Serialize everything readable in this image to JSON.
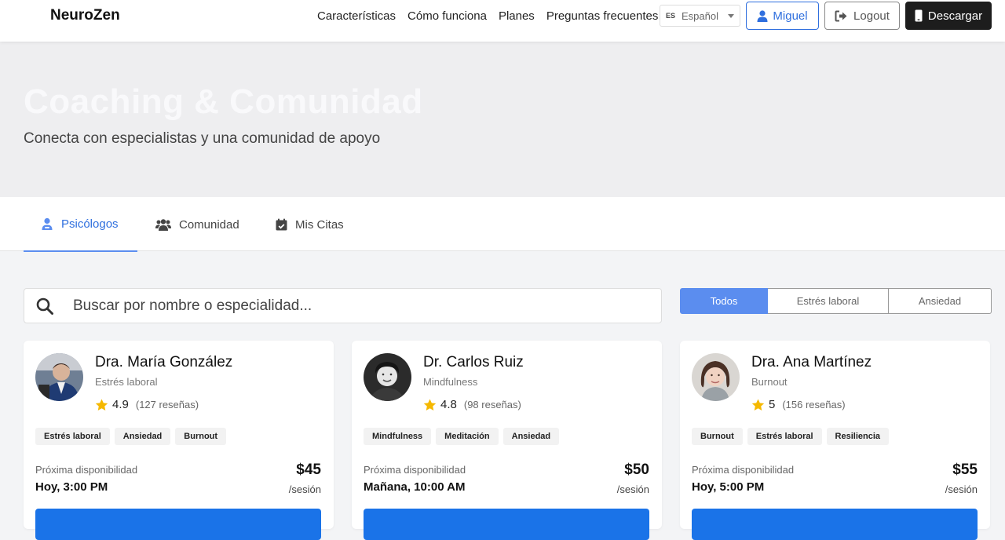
{
  "navbar": {
    "brand": "NeuroZen",
    "links": [
      "Características",
      "Cómo funciona",
      "Planes",
      "Preguntas frecuentes"
    ],
    "language": {
      "code": "ES",
      "label": "Español"
    },
    "user_label": "Miguel",
    "logout_label": "Logout",
    "download_label": "Descargar"
  },
  "hero": {
    "title": "Coaching & Comunidad",
    "subtitle": "Conecta con especialistas y una comunidad de apoyo"
  },
  "tabs": [
    {
      "label": "Psicólogos",
      "icon": "psychologist-icon",
      "active": true
    },
    {
      "label": "Comunidad",
      "icon": "users-icon",
      "active": false
    },
    {
      "label": "Mis Citas",
      "icon": "calendar-check-icon",
      "active": false
    }
  ],
  "search": {
    "placeholder": "Buscar por nombre o especialidad..."
  },
  "filters": [
    "Todos",
    "Estrés laboral",
    "Ansiedad"
  ],
  "psychologists": [
    {
      "name": "Dra. María González",
      "specialty": "Estrés laboral",
      "rating": "4.9",
      "reviews": "(127 reseñas)",
      "tags": [
        "Estrés laboral",
        "Ansiedad",
        "Burnout"
      ],
      "availability_label": "Próxima disponibilidad",
      "availability": "Hoy, 3:00 PM",
      "price": "$45",
      "per": "/sesión"
    },
    {
      "name": "Dr. Carlos Ruiz",
      "specialty": "Mindfulness",
      "rating": "4.8",
      "reviews": "(98 reseñas)",
      "tags": [
        "Mindfulness",
        "Meditación",
        "Ansiedad"
      ],
      "availability_label": "Próxima disponibilidad",
      "availability": "Mañana, 10:00 AM",
      "price": "$50",
      "per": "/sesión"
    },
    {
      "name": "Dra. Ana Martínez",
      "specialty": "Burnout",
      "rating": "5",
      "reviews": "(156 reseñas)",
      "tags": [
        "Burnout",
        "Estrés laboral",
        "Resiliencia"
      ],
      "availability_label": "Próxima disponibilidad",
      "availability": "Hoy, 5:00 PM",
      "price": "$55",
      "per": "/sesión"
    }
  ],
  "colors": {
    "accent": "#2f6fde",
    "filter_active": "#5b8def",
    "primary_button": "#1a73e8",
    "star": "#f5b800",
    "download_bg": "#1d1d1d"
  }
}
